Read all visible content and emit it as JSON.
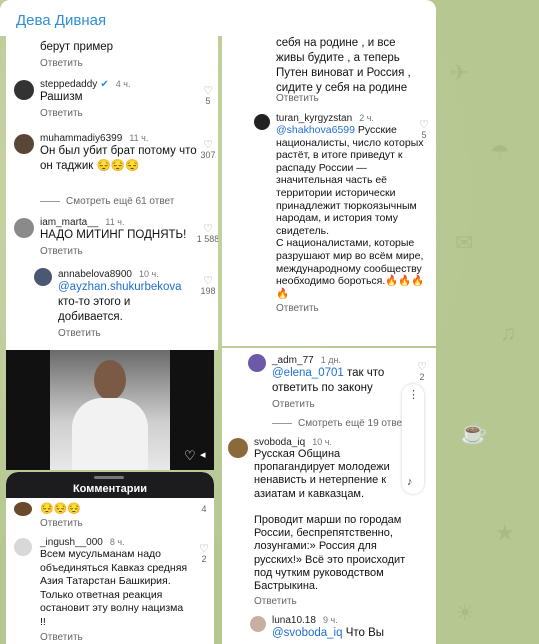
{
  "chat": {
    "title": "Дева Дивная"
  },
  "left_top": {
    "fragment_top": "берут пример",
    "fragment_reply": "Ответить",
    "comments": [
      {
        "user": "steppedaddy",
        "badge": "✔",
        "time": "4 ч.",
        "text": "Рашизм",
        "reply": "Ответить",
        "likes": "5"
      },
      {
        "user": "muhammadiy6399",
        "time": "11 ч.",
        "text": "Он был убит брат потому что он таджик 😔😔😔",
        "reply": "Ответить",
        "likes": "307",
        "more": "Смотреть ещё 61 ответ"
      },
      {
        "user": "iam_marta__",
        "time": "11 ч.",
        "text": "НАДО МИТИНГ ПОДНЯТЬ!",
        "reply": "Ответить",
        "likes": "1 588"
      },
      {
        "user": "annabelova8900",
        "time": "10 ч.",
        "mention": "@ayzhan.shukurbekova",
        "text": "кто-то этого и добивается.",
        "reply": "Ответить",
        "likes": "198"
      }
    ]
  },
  "left_bottom": {
    "sheet_title": "Комментарии",
    "partial_emojis": "😔😔😔",
    "partial_reply": "Ответить",
    "partial_likes": "4",
    "comment": {
      "user": "_ingush__000",
      "time": "8 ч.",
      "text": "Всем мусульманам надо объединяться Кавказ средняя Азия Татарстан Башкирия. Только ответная реакция  остановит эту волну нацизма !!",
      "reply": "Ответить",
      "likes": "2"
    }
  },
  "right_top": {
    "fragment_text": "себя на родине , и все живы будите , а теперь Путен виноват и Россия , сидите у себя на родине",
    "fragment_reply": "Ответить",
    "comment": {
      "user": "turan_kyrgyzstan",
      "time": "2 ч.",
      "mention": "@shakhova6599",
      "text": "Русские националисты, число которых растёт, в итоге приведут к распаду России — значительная часть её территории исторически принадлежит тюркоязычным народам, и история тому свидетель.\nС националистами, которые разрушают мир во всём мире, международному сообществу необходимо бороться.🔥🔥🔥🔥",
      "reply": "Ответить",
      "likes": "5"
    }
  },
  "right_bottom": {
    "comments": [
      {
        "user": "_adm_77",
        "time": "1 дн.",
        "mention": "@elena_0701",
        "text": "так что ответить по закону",
        "reply": "Ответить",
        "likes": "2",
        "more": "Смотреть ещё 19 ответов"
      },
      {
        "user": "svoboda_iq",
        "time": "10 ч.",
        "text": "Русская Община пропагандирует молодежи ненависть и нетерпение к азиатам и кавказцам.\n\nПроводит марши по городам России, беспрепятственно, лозунгами:» Россия для русских!» Всё это происходит под чутким руководством Бастрыкина.",
        "reply": "Ответить"
      },
      {
        "user": "luna10.18",
        "time": "9 ч.",
        "mention": "@svoboda_iq",
        "text": "Что Вы"
      }
    ]
  }
}
